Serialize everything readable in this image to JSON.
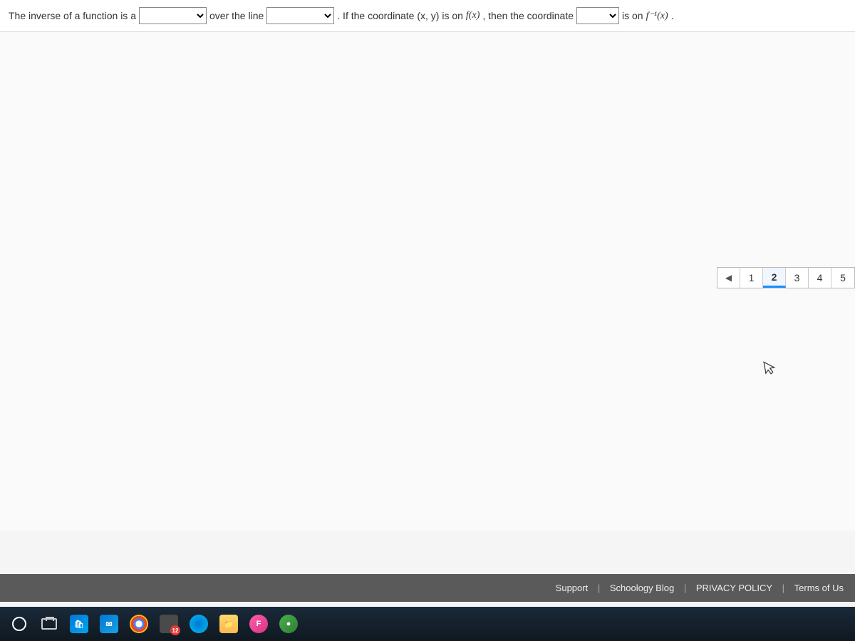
{
  "question": {
    "part1": "The inverse of a function is a",
    "part2": "over the line",
    "part3": ". If the coordinate (x, y) is on ",
    "fx": "f(x)",
    "part4": ", then the coordinate",
    "part5": "is on ",
    "finvx": "f⁻¹(x)",
    "period": "."
  },
  "dropdowns": {
    "blank1": "",
    "blank2": "",
    "blank3": ""
  },
  "pagination": {
    "prev": "◀",
    "pages": [
      "1",
      "2",
      "3",
      "4",
      "5"
    ],
    "active_index": 1
  },
  "footer": {
    "support": "Support",
    "blog": "Schoology Blog",
    "privacy": "PRIVACY POLICY",
    "terms": "Terms of Us"
  },
  "taskbar": {
    "calc_badge": "12"
  }
}
